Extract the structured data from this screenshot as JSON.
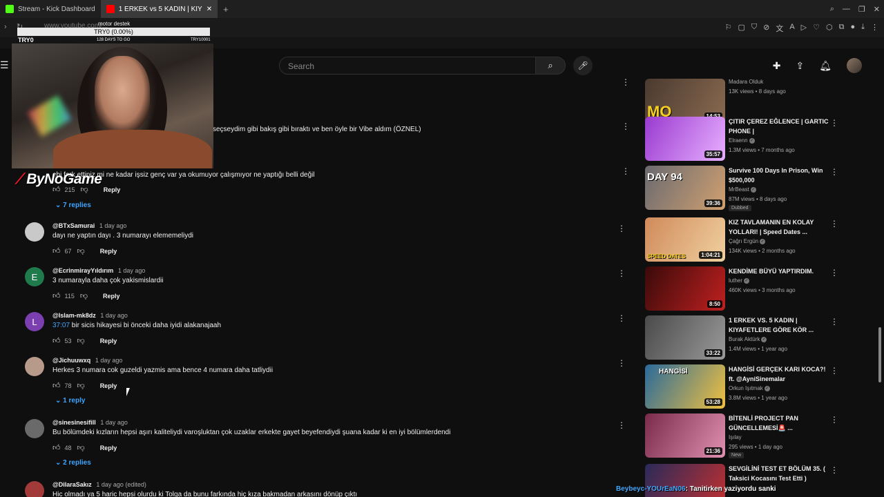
{
  "browser": {
    "tabs": [
      {
        "label": "Stream - Kick Dashboard",
        "favicon_color": "#53fc18"
      },
      {
        "label": "1 ERKEK vs 5 KADIN | KIY",
        "favicon_color": "#ff0000"
      }
    ],
    "new_tab": "+",
    "url": "www.youtube.com/..."
  },
  "overlay": {
    "goal_title": "motor destek",
    "goal_progress": "TRY0 (0.00%)",
    "left_label": "TRY0",
    "days_label": "128 DAYS TO GO",
    "right_label": "TRY10001",
    "brand": "ByNoGame",
    "progress_fraction": 0.0
  },
  "header": {
    "search_placeholder": "Search"
  },
  "fragments": [
    {
      "text": "seçseydim gibi bakış gibi bıraktı ve ben öyle bir Vibe aldım (ÖZNEL)"
    },
    {
      "text": "ebi fark ettiniz mi ne kadar işsiz genç var ya okumuyor çalışmıyor ne yaptığı belli değil"
    },
    {
      "likes": "215",
      "reply": "Reply"
    },
    {
      "replies": "7 replies"
    }
  ],
  "comments": [
    {
      "author": "@BTxSamurai",
      "time": "1 day ago",
      "text": "dayı ne yaptın dayı . 3 numarayı elememeliydi",
      "likes": "67",
      "reply": "Reply",
      "avatar_letter": "",
      "avatar_color": "#c9c9c9"
    },
    {
      "author": "@EcrinmirayYıldırım",
      "time": "1 day ago",
      "text": "3 numarayla daha çok yakismislardii",
      "likes": "115",
      "reply": "Reply",
      "avatar_letter": "E",
      "avatar_color": "#1f7a4c"
    },
    {
      "author": "@Islam-mk8dz",
      "time": "1 day ago",
      "timestamp": "37:07",
      "text": " bir sicis hikayesi bi önceki daha iyidi alakanajaah",
      "likes": "53",
      "reply": "Reply",
      "avatar_letter": "L",
      "avatar_color": "#7b3fb0"
    },
    {
      "author": "@Jichuuwxq",
      "time": "1 day ago",
      "text": "Herkes 3 numara cok guzeldi yazmis ama bence 4 numara daha tatliydii",
      "likes": "78",
      "reply": "Reply",
      "avatar_letter": "",
      "avatar_color": "#b89a8a",
      "replies": "1 reply"
    },
    {
      "author": "@sinesinesifill",
      "time": "1 day ago",
      "text": "Bu bölümdeki kızların hepsi aşırı kaliteliydi varoşluktan çok uzaklar erkekte gayet beyefendiydi şuana kadar ki en iyi bölümlerdendi",
      "likes": "48",
      "reply": "Reply",
      "avatar_letter": "",
      "avatar_color": "#6a6a6a",
      "replies": "2 replies"
    },
    {
      "author": "@DilaraSakız",
      "time": "1 day ago (edited)",
      "text": "Hic olmadı ya 5 haric hepsi olurdu ki Tolga da bunu farkında hiç kıza bakmadan arkasını dönüp çıktı",
      "likes": "",
      "reply": "",
      "avatar_letter": "",
      "avatar_color": "#a23a3a"
    }
  ],
  "sidebar": {
    "videos": [
      {
        "title": "",
        "channel": "Madara Olduk",
        "meta": "13K views • 8 days ago",
        "duration": "14:53",
        "thumb_label": "MO",
        "color1": "#4a3a30",
        "color2": "#8a6a50"
      },
      {
        "title": "ÇITIR ÇEREZ EĞLENCE | GARTIC PHONE |",
        "channel": "Elraenn",
        "verified": true,
        "meta": "1.3M views • 7 months ago",
        "duration": "35:57",
        "thumb_label": "",
        "color1": "#9a3ad0",
        "color2": "#e8b0ff"
      },
      {
        "title": "Survive 100 Days In Prison, Win $500,000",
        "channel": "MrBeast",
        "verified": true,
        "meta": "87M views • 8 days ago",
        "badge": "Dubbed",
        "duration": "39:36",
        "thumb_label": "DAY 94",
        "color1": "#6a6a70",
        "color2": "#d0a070"
      },
      {
        "title": "KIZ TAVLAMANIN EN KOLAY YOLLARI! | Speed Dates ...",
        "channel": "Çağrı Ergün",
        "verified": true,
        "meta": "134K views • 2 months ago",
        "duration": "1:04:21",
        "thumb_label": "SPEED DATES",
        "color1": "#d08a5a",
        "color2": "#f0d0a0"
      },
      {
        "title": "KENDİME BÜYÜ YAPTIRDIM.",
        "channel": "luther",
        "verified": true,
        "meta": "460K views • 3 months ago",
        "duration": "8:50",
        "thumb_label": "",
        "color1": "#3a0a0a",
        "color2": "#c02020"
      },
      {
        "title": "1 ERKEK VS. 5 KADIN | KIYAFETLERE GÖRE KÖR ...",
        "channel": "Burak Aktürk",
        "verified": true,
        "meta": "1.4M views • 1 year ago",
        "duration": "33:22",
        "thumb_label": "",
        "color1": "#4a4a4a",
        "color2": "#9a9a9a"
      },
      {
        "title": "HANGİSİ GERÇEK KARI KOCA?! ft. @AyniSinemalar",
        "channel": "Orkun Işıtmak",
        "verified": true,
        "meta": "3.8M views • 1 year ago",
        "duration": "53:28",
        "thumb_label": "HANGİSİ",
        "color1": "#2a6a9a",
        "color2": "#f0c040"
      },
      {
        "title": "BİTENLİ PROJECT PAN GÜNCELLEMESİ🚨 ...",
        "channel": "Işılay",
        "meta": "295 views • 1 day ago",
        "badge": "New",
        "duration": "21:36",
        "thumb_label": "",
        "color1": "#7a2a4a",
        "color2": "#e090b0"
      },
      {
        "title": "SEVGİLİNİ TEST ET BÖLÜM 35. ( Taksici Kocasını Test Etti )",
        "channel": "",
        "meta": "",
        "duration": "",
        "thumb_label": "",
        "color1": "#2a2a5a",
        "color2": "#c03030"
      }
    ]
  },
  "chat": {
    "user": "Beybeyc-YOUrEaN06",
    "message": ": Tanitirken yaziyordu sanki"
  }
}
